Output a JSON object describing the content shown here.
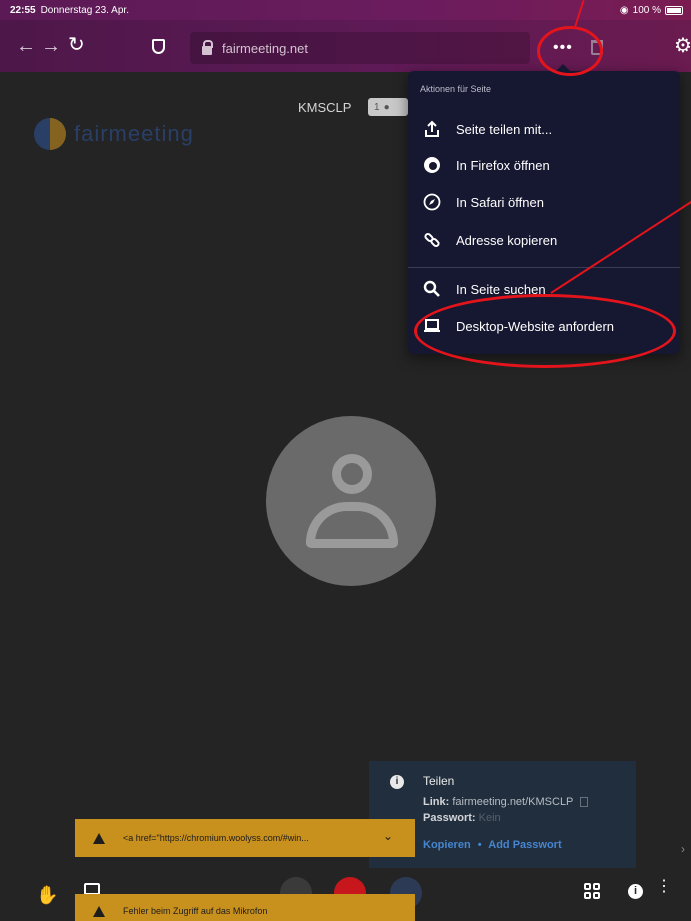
{
  "status": {
    "time": "22:55",
    "date": "Donnerstag 23. Apr.",
    "battery": "100 %"
  },
  "browser": {
    "url": "fairmeeting.net"
  },
  "page": {
    "logo_text": "fairmeeting",
    "room_name": "KMSCLP",
    "participant_count": "1"
  },
  "menu": {
    "title": "Aktionen für Seite",
    "items": [
      {
        "label": "Seite teilen mit...",
        "icon": "share-icon"
      },
      {
        "label": "In Firefox öffnen",
        "icon": "firefox-icon"
      },
      {
        "label": "In Safari öffnen",
        "icon": "safari-compass-icon"
      },
      {
        "label": "Adresse kopieren",
        "icon": "link-icon"
      },
      {
        "label": "In Seite suchen",
        "icon": "search-icon"
      },
      {
        "label": "Desktop-Website anfordern",
        "icon": "laptop-icon"
      }
    ]
  },
  "info_panel": {
    "title": "Teilen",
    "link_label": "Link:",
    "link_value": "fairmeeting.net/KMSCLP",
    "password_label": "Passwort:",
    "password_value": "Kein",
    "copy_label": "Kopieren",
    "separator": "•",
    "add_password_label": "Add Passwort"
  },
  "warnings": [
    {
      "text": "<a href=\"https://chromium.woolyss.com/#win..."
    },
    {
      "text": "Fehler beim Zugriff auf das Mikrofon"
    }
  ],
  "colors": {
    "annotation_red": "#e3141b",
    "toolbar_purple": "#5e1a56",
    "menu_bg": "#161730",
    "warning_bg": "#c8901c",
    "link_blue": "#4a90e2"
  }
}
